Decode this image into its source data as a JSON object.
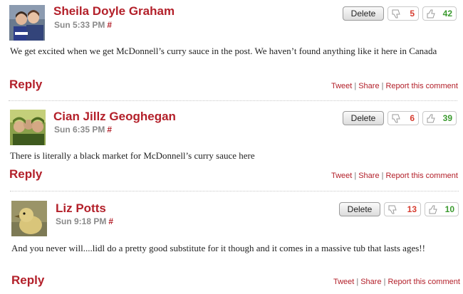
{
  "comments": [
    {
      "author": "Sheila Doyle Graham",
      "time": "Sun 5:33 PM",
      "hash": "#",
      "text": "We get excited when we get McDonnell’s curry sauce in the post. We haven’t found anything like it here in Canada",
      "down": "5",
      "up": "42",
      "avatar": "two-people-avatar"
    },
    {
      "author": "Cian Jillz Geoghegan",
      "time": "Sun 6:35 PM",
      "hash": "#",
      "text": "There is literally a black market for McDonnell’s curry sauce here",
      "down": "6",
      "up": "39",
      "avatar": "group-avatar"
    },
    {
      "author": "Liz Potts",
      "time": "Sun 9:18 PM",
      "hash": "#",
      "text": "And you never will....lidl do a pretty good substitute for it though and it comes in a massive tub that lasts ages!!",
      "down": "13",
      "up": "10",
      "avatar": "duckling-avatar"
    }
  ],
  "labels": {
    "delete": "Delete",
    "reply": "Reply",
    "tweet": "Tweet",
    "share": "Share",
    "report": "Report this comment",
    "sep": "|"
  },
  "colors": {
    "accent": "#b3202a",
    "up": "#3a9a2e",
    "down": "#d63c2f"
  }
}
